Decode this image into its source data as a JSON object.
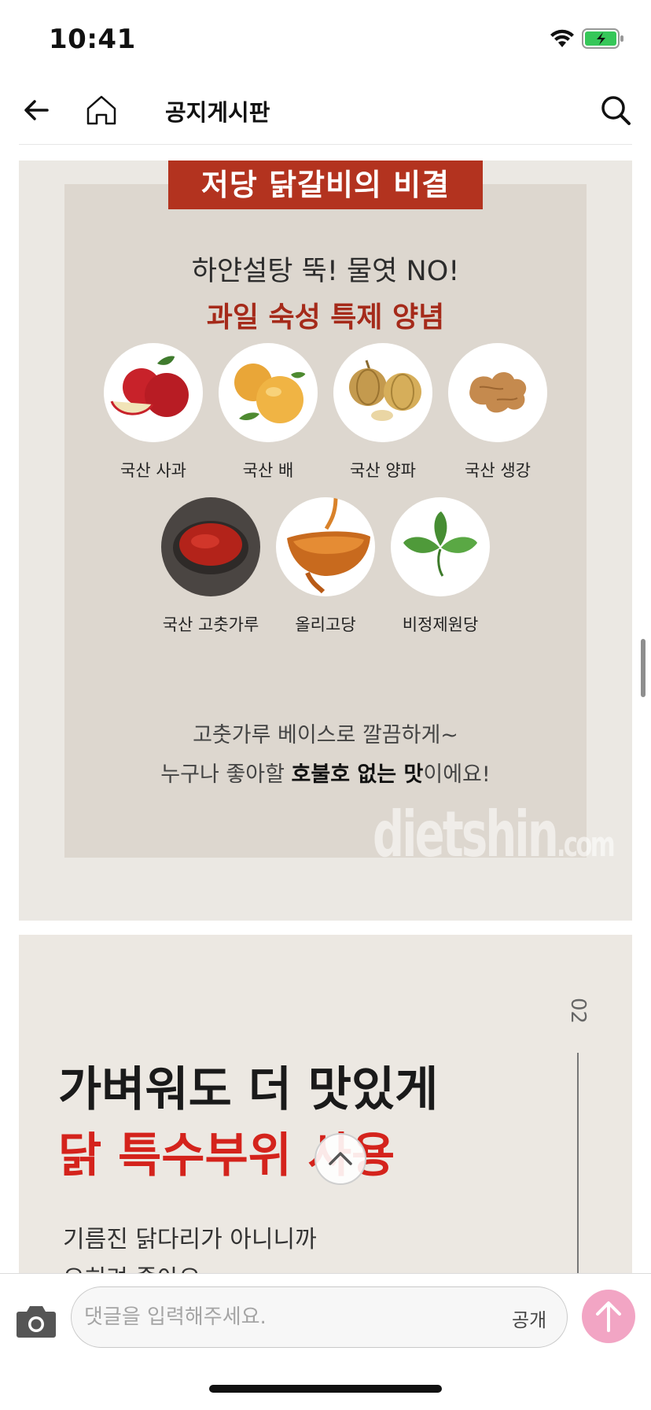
{
  "status_bar": {
    "time": "10:41",
    "battery_color": "#36c759"
  },
  "nav": {
    "title": "공지게시판"
  },
  "post": {
    "panel1": {
      "banner": "저당 닭갈비의 비결",
      "headline_line1": "하얀설탕 뚝! 물엿 NO!",
      "headline_line2": "과일 숙성 특제 양념",
      "ingredients": [
        {
          "label": "국산 사과",
          "icon": "apple-icon"
        },
        {
          "label": "국산 배",
          "icon": "pear-icon"
        },
        {
          "label": "국산 양파",
          "icon": "onion-icon"
        },
        {
          "label": "국산 생강",
          "icon": "ginger-icon"
        },
        {
          "label": "국산 고춧가루",
          "icon": "chili-powder-icon"
        },
        {
          "label": "올리고당",
          "icon": "syrup-icon"
        },
        {
          "label": "비정제원당",
          "icon": "mint-leaf-icon"
        }
      ],
      "desc_line1": "고춧가루 베이스로 깔끔하게~",
      "desc_line2_pre": "누구나 좋아할 ",
      "desc_line2_bold": "호불호 없는 맛",
      "desc_line2_post": "이에요!",
      "watermark": "dietshin",
      "watermark_suffix": ".com"
    },
    "panel2": {
      "section_number": "02",
      "title_line1": "가벼워도 더 맛있게",
      "title_line2": "닭 특수부위 사용",
      "text_line1": "기름진 닭다리가 아니니까",
      "text_line2": "오히려 좋아요"
    }
  },
  "comment_bar": {
    "placeholder": "댓글을 입력해주세요.",
    "visibility_label": "공개",
    "send_color": "#f2a5c4"
  }
}
